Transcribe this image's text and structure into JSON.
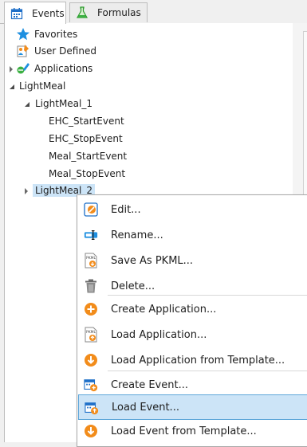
{
  "tabs": {
    "events": "Events",
    "formulas": "Formulas"
  },
  "tree": {
    "favorites": "Favorites",
    "user_defined": "User Defined",
    "applications": "Applications",
    "lightmeal": "LightMeal",
    "lightmeal_1": "LightMeal_1",
    "ehc_start": "EHC_StartEvent",
    "ehc_stop": "EHC_StopEvent",
    "meal_start": "Meal_StartEvent",
    "meal_stop": "Meal_StopEvent",
    "lightmeal_2": "LightMeal_2"
  },
  "context_menu": {
    "edit": "Edit...",
    "rename": "Rename...",
    "save_as_pkml": "Save As PKML...",
    "delete": "Delete...",
    "create_application": "Create Application...",
    "load_application": "Load Application...",
    "load_application_template": "Load Application from Template...",
    "create_event": "Create Event...",
    "load_event": "Load Event...",
    "load_event_template": "Load Event from Template...",
    "highlighted_item": "Load Event..."
  },
  "colors": {
    "accent_blue": "#1e90e0",
    "orange": "#f28c1b",
    "selection": "#cce4f7"
  }
}
